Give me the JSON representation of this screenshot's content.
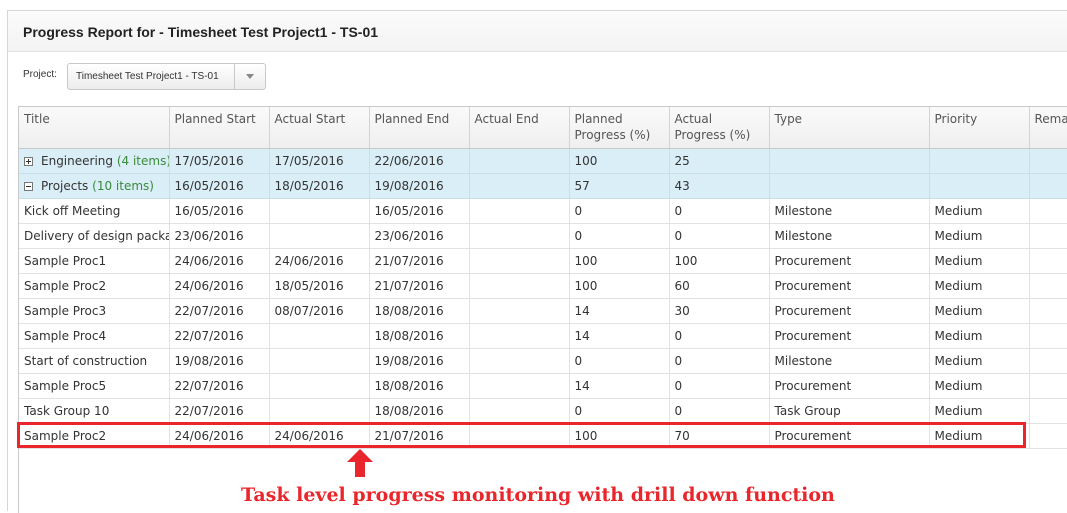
{
  "panel": {
    "title": "Progress Report for - Timesheet Test Project1 - TS-01"
  },
  "project_filter": {
    "label": "Project:",
    "selected": "Timesheet Test Project1 - TS-01",
    "button_icon": "chevron-down-icon"
  },
  "columns": [
    {
      "line1": "Title",
      "line2": ""
    },
    {
      "line1": "Planned Start",
      "line2": ""
    },
    {
      "line1": "Actual Start",
      "line2": ""
    },
    {
      "line1": "Planned End",
      "line2": ""
    },
    {
      "line1": "Actual End",
      "line2": ""
    },
    {
      "line1": "Planned",
      "line2": "Progress (%)"
    },
    {
      "line1": "Actual",
      "line2": "Progress (%)"
    },
    {
      "line1": "Type",
      "line2": ""
    },
    {
      "line1": "Priority",
      "line2": ""
    },
    {
      "line1": "Remaining",
      "line2": ""
    }
  ],
  "groups": [
    {
      "icon": "expand-icon",
      "name": "Engineering",
      "count": "(4 items)",
      "planned_start": "17/05/2016",
      "actual_start": "17/05/2016",
      "planned_end": "22/06/2016",
      "actual_end": "",
      "planned_progress": "100",
      "actual_progress": "25",
      "type": "",
      "priority": "",
      "remaining": ""
    },
    {
      "icon": "collapse-icon",
      "name": "Projects",
      "count": "(10 items)",
      "planned_start": "16/05/2016",
      "actual_start": "18/05/2016",
      "planned_end": "19/08/2016",
      "actual_end": "",
      "planned_progress": "57",
      "actual_progress": "43",
      "type": "",
      "priority": "",
      "remaining": ""
    }
  ],
  "rows": [
    {
      "title": "Kick off Meeting",
      "planned_start": "16/05/2016",
      "actual_start": "",
      "planned_end": "16/05/2016",
      "actual_end": "",
      "planned_progress": "0",
      "actual_progress": "0",
      "type": "Milestone",
      "priority": "Medium",
      "remaining": ""
    },
    {
      "title": "Delivery of design package",
      "planned_start": "23/06/2016",
      "actual_start": "",
      "planned_end": "23/06/2016",
      "actual_end": "",
      "planned_progress": "0",
      "actual_progress": "0",
      "type": "Milestone",
      "priority": "Medium",
      "remaining": ""
    },
    {
      "title": "Sample Proc1",
      "planned_start": "24/06/2016",
      "actual_start": "24/06/2016",
      "planned_end": "21/07/2016",
      "actual_end": "",
      "planned_progress": "100",
      "actual_progress": "100",
      "type": "Procurement",
      "priority": "Medium",
      "remaining": ""
    },
    {
      "title": "Sample Proc2",
      "planned_start": "24/06/2016",
      "actual_start": "18/05/2016",
      "planned_end": "21/07/2016",
      "actual_end": "",
      "planned_progress": "100",
      "actual_progress": "60",
      "type": "Procurement",
      "priority": "Medium",
      "remaining": ""
    },
    {
      "title": "Sample Proc3",
      "planned_start": "22/07/2016",
      "actual_start": "08/07/2016",
      "planned_end": "18/08/2016",
      "actual_end": "",
      "planned_progress": "14",
      "actual_progress": "30",
      "type": "Procurement",
      "priority": "Medium",
      "remaining": ""
    },
    {
      "title": "Sample Proc4",
      "planned_start": "22/07/2016",
      "actual_start": "",
      "planned_end": "18/08/2016",
      "actual_end": "",
      "planned_progress": "14",
      "actual_progress": "0",
      "type": "Procurement",
      "priority": "Medium",
      "remaining": ""
    },
    {
      "title": "Start of construction",
      "planned_start": "19/08/2016",
      "actual_start": "",
      "planned_end": "19/08/2016",
      "actual_end": "",
      "planned_progress": "0",
      "actual_progress": "0",
      "type": "Milestone",
      "priority": "Medium",
      "remaining": ""
    },
    {
      "title": "Sample Proc5",
      "planned_start": "22/07/2016",
      "actual_start": "",
      "planned_end": "18/08/2016",
      "actual_end": "",
      "planned_progress": "14",
      "actual_progress": "0",
      "type": "Procurement",
      "priority": "Medium",
      "remaining": ""
    },
    {
      "title": "Task Group 10",
      "planned_start": "22/07/2016",
      "actual_start": "",
      "planned_end": "18/08/2016",
      "actual_end": "",
      "planned_progress": "0",
      "actual_progress": "0",
      "type": "Task Group",
      "priority": "Medium",
      "remaining": ""
    },
    {
      "title": "Sample Proc2",
      "planned_start": "24/06/2016",
      "actual_start": "24/06/2016",
      "planned_end": "21/07/2016",
      "actual_end": "",
      "planned_progress": "100",
      "actual_progress": "70",
      "type": "Procurement",
      "priority": "Medium",
      "remaining": ""
    }
  ],
  "annotation": {
    "caption": "Task level progress monitoring with drill down function",
    "color": "#e8262b",
    "arrow_icon": "up-arrow-icon"
  }
}
